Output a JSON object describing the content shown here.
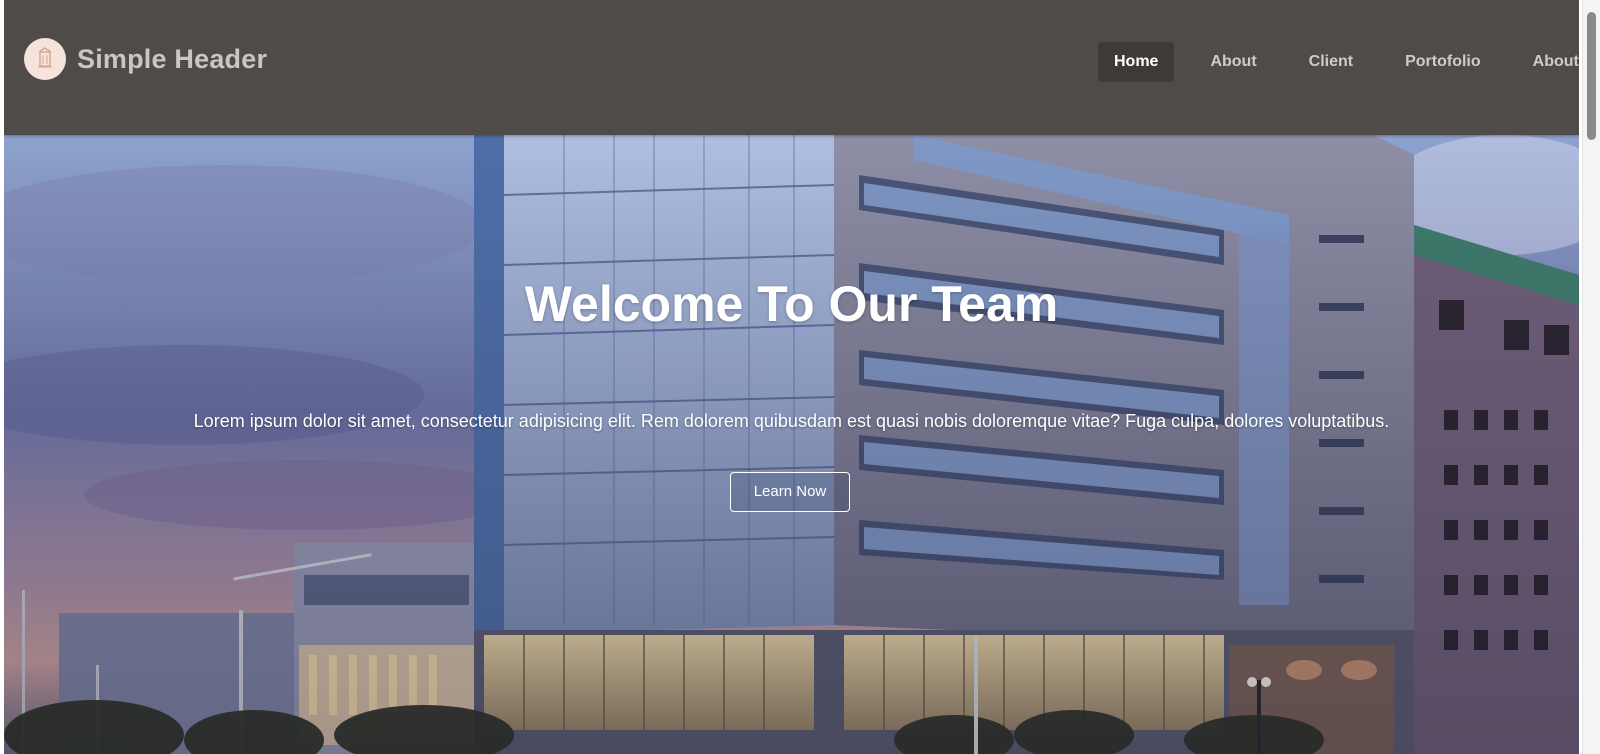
{
  "header": {
    "site_title": "Simple Header",
    "logo_icon": "building-logo-icon",
    "nav": [
      {
        "label": "Home",
        "active": true
      },
      {
        "label": "About",
        "active": false
      },
      {
        "label": "Client",
        "active": false
      },
      {
        "label": "Portofolio",
        "active": false
      },
      {
        "label": "About",
        "active": false
      }
    ]
  },
  "hero": {
    "title": "Welcome To Our Team",
    "text": "Lorem ipsum dolor sit amet, consectetur adipisicing elit. Rem dolorem quibusdam est quasi nobis doloremque vitae? Fuga culpa, dolores voluptatibus.",
    "button_label": "Learn Now",
    "background": "office-building-at-dusk-photo"
  },
  "colors": {
    "header_bg": "#4f4b49",
    "nav_active_bg": "#3f3a37",
    "nav_text": "#cfcbc7",
    "nav_active_text": "#ffffff",
    "hero_text": "#ffffff"
  }
}
